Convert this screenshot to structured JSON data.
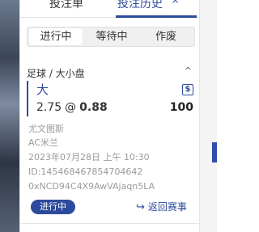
{
  "tabs": {
    "bet_slip": "投注单",
    "bet_history": "投注历史"
  },
  "filters": [
    "进行中",
    "等待中",
    "作废"
  ],
  "bet": {
    "market": "足球 / 大小盘",
    "selection": "大",
    "line": "2.75",
    "at": "@",
    "odds": "0.88",
    "stake": "100",
    "currency_symbol": "$",
    "home_team": "尤文图斯",
    "away_team": "AC米兰",
    "datetime": "2023年07月28日 上午 10:30",
    "id_text": "ID:145468467854704642",
    "tx_hash": "0xNCD94C4X9AwVAjaqn5LA",
    "status": "进行中",
    "return_label": "返回赛事"
  },
  "colors": {
    "accent": "#2d4b9c",
    "muted_text": "#9a9a9a"
  },
  "icons": [
    "chevron-up-icon",
    "dollar-icon",
    "return-icon"
  ]
}
